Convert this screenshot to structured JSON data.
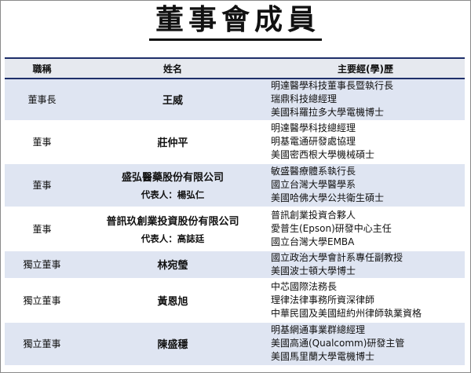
{
  "title": "董事會成員",
  "headers": {
    "role": "職稱",
    "name": "姓名",
    "experience": "主要經(學)歷"
  },
  "rows": [
    {
      "role": "董事長",
      "name": "王威",
      "rep": "",
      "experience": [
        "明達醫學科技董事長暨執行長",
        "瑞鼎科技總經理",
        "美國科羅拉多大學電機博士"
      ]
    },
    {
      "role": "董事",
      "name": "莊仲平",
      "rep": "",
      "experience": [
        "明達醫學科技總經理",
        "明基電通研發處協理",
        "美國密西根大學機械碩士"
      ]
    },
    {
      "role": "董事",
      "name": "盛弘醫藥股份有限公司",
      "rep": "代表人：楊弘仁",
      "experience": [
        "敏盛醫療體系執行長",
        "國立台灣大學醫學系",
        "美國哈佛大學公共衛生碩士"
      ]
    },
    {
      "role": "董事",
      "name": "普訊玖創業投資股份有限公司",
      "rep": "代表人：高誌廷",
      "experience": [
        "普訊創業投資合夥人",
        "愛普生(Epson)研發中心主任",
        "國立台灣大學EMBA"
      ]
    },
    {
      "role": "獨立董事",
      "name": "林宛瑩",
      "rep": "",
      "experience": [
        "國立政治大學會計系專任副教授",
        "美國波士頓大學博士"
      ]
    },
    {
      "role": "獨立董事",
      "name": "黃恩旭",
      "rep": "",
      "experience": [
        "中芯國際法務長",
        "理律法律事務所資深律師",
        "中華民國及美國紐約州律師執業資格"
      ]
    },
    {
      "role": "獨立董事",
      "name": "陳盛穩",
      "rep": "",
      "experience": [
        "明基網通事業群總經理",
        "美國高通(Qualcomm)研發主管",
        "美國馬里蘭大學電機博士"
      ]
    }
  ]
}
